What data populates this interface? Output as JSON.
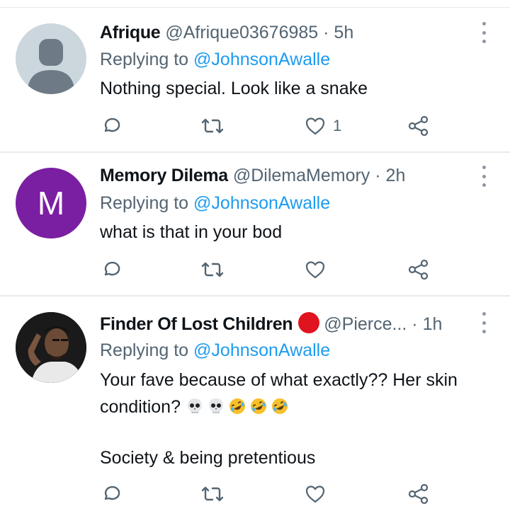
{
  "tweets": [
    {
      "name": "Afrique",
      "handle": "@Afrique03676985",
      "time": "· 5h",
      "replying_prefix": "Replying to ",
      "replying_mention": "@JohnsonAwalle",
      "text_lines": [
        "Nothing special. Look like a snake"
      ],
      "like_count": "1",
      "avatar": "default-avatar-icon"
    },
    {
      "name": "Memory Dilema",
      "handle": "@DilemaMemory",
      "time": "· 2h",
      "replying_prefix": "Replying to ",
      "replying_mention": "@JohnsonAwalle",
      "text_lines": [
        "what is that in your bod"
      ],
      "like_count": "",
      "avatar_letter": "M"
    },
    {
      "name": "Finder Of Lost Children",
      "handle": "@Pierce...",
      "time": "· 1h",
      "replying_prefix": "Replying to ",
      "replying_mention": "@JohnsonAwalle",
      "text_lines": [
        "Your fave because of what exactly?? Her skin",
        "condition?",
        "",
        "Society &  being pretentious"
      ],
      "like_count": "",
      "avatar": "user-photo"
    }
  ],
  "colors": {
    "text": "#0f1419",
    "secondary": "#536471",
    "link": "#1d9bf0",
    "avatar_letter_bg": "#7b1fa2",
    "red_circle": "#e0141e"
  },
  "icons": [
    "reply-icon",
    "retweet-icon",
    "like-icon",
    "share-icon",
    "more-icon",
    "skull-emoji",
    "rofl-emoji"
  ]
}
